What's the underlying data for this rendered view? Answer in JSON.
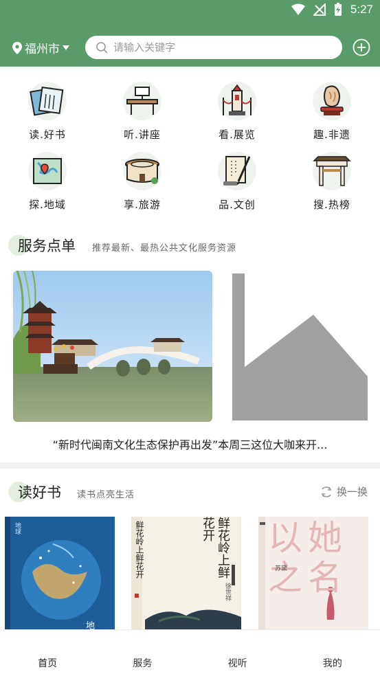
{
  "status_bar": {
    "time": "5:27"
  },
  "header": {
    "city": "福州市",
    "search_placeholder": "请输入关键字"
  },
  "categories": [
    {
      "label": "读.好书",
      "icon": "book-scroll-icon"
    },
    {
      "label": "听.讲座",
      "icon": "lecture-desk-icon"
    },
    {
      "label": "看.展览",
      "icon": "exhibition-tower-icon"
    },
    {
      "label": "趣.非遗",
      "icon": "heritage-stone-icon"
    },
    {
      "label": "探.地域",
      "icon": "map-icon"
    },
    {
      "label": "享.旅游",
      "icon": "tulou-icon"
    },
    {
      "label": "品.文创",
      "icon": "brush-scroll-icon"
    },
    {
      "label": "搜.热榜",
      "icon": "archway-icon"
    }
  ],
  "service": {
    "title": "服务点单",
    "subtitle": "推荐最新、最热公共文化服务资源",
    "caption": "“新时代闽南文化生态保护再出发”本周三这位大咖来开..."
  },
  "reading": {
    "title": "读好书",
    "subtitle": "读书点亮生活",
    "refresh_label": "换一换",
    "books": [
      {
        "cover_text": "地",
        "side_text": "地球"
      },
      {
        "cover_text": "鲜花岭上鲜花开",
        "author": "徐世祥"
      },
      {
        "cover_text": "以她之名",
        "author": "苏黛"
      }
    ]
  },
  "bottom_nav": [
    {
      "label": "首页"
    },
    {
      "label": "服务"
    },
    {
      "label": "视听"
    },
    {
      "label": "我的"
    }
  ],
  "colors": {
    "header": "#5a9b6a",
    "accent_light": "#e3eedf"
  }
}
